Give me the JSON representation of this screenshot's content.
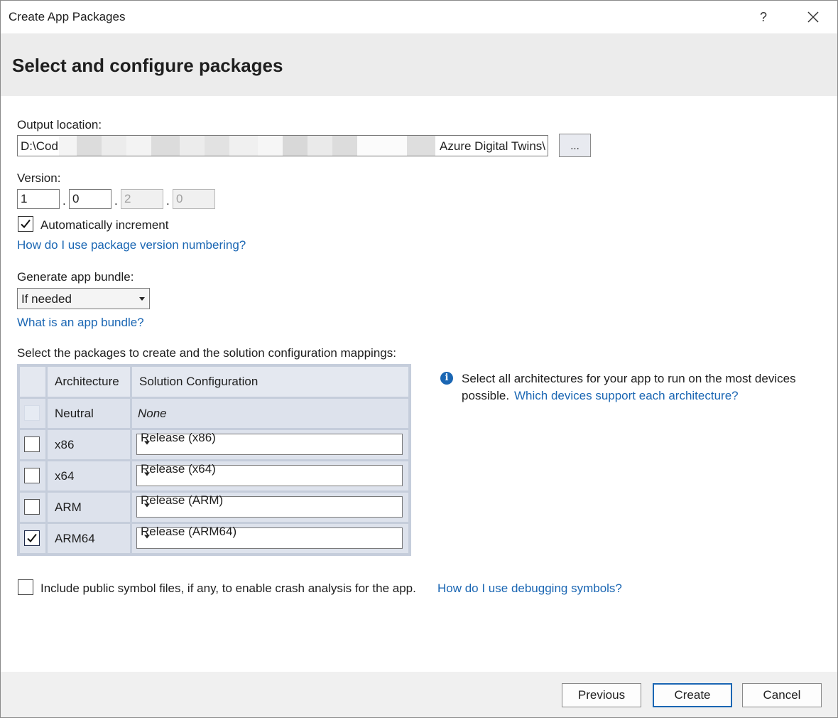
{
  "window": {
    "title": "Create App Packages",
    "help_glyph": "?"
  },
  "header": {
    "title": "Select and configure packages"
  },
  "output": {
    "label": "Output location:",
    "path_prefix": "D:\\Cod",
    "path_suffix": "Azure Digital Twins\\",
    "browse_label": "..."
  },
  "version": {
    "label": "Version:",
    "major": "1",
    "minor": "0",
    "build": "2",
    "revision": "0",
    "separator": ".",
    "auto_increment_label": "Automatically increment",
    "auto_increment_checked": true,
    "help_link": "How do I use package version numbering?"
  },
  "bundle": {
    "label": "Generate app bundle:",
    "value": "If needed",
    "help_link": "What is an app bundle?"
  },
  "packages": {
    "label": "Select the packages to create and the solution configuration mappings:",
    "columns": [
      "Architecture",
      "Solution Configuration"
    ],
    "rows": [
      {
        "arch": "Neutral",
        "config": "None",
        "checked": false
      },
      {
        "arch": "x86",
        "config": "Release (x86)",
        "checked": false
      },
      {
        "arch": "x64",
        "config": "Release (x64)",
        "checked": false
      },
      {
        "arch": "ARM",
        "config": "Release (ARM)",
        "checked": false
      },
      {
        "arch": "ARM64",
        "config": "Release (ARM64)",
        "checked": true
      }
    ]
  },
  "info": {
    "text_line1": "Select all architectures for your app to run on the most devices",
    "text_line2": "possible.",
    "link": "Which devices support each architecture?"
  },
  "symbols": {
    "label": "Include public symbol files, if any, to enable crash analysis for the app.",
    "link": "How do I use debugging symbols?",
    "checked": false
  },
  "footer": {
    "previous_label": "Previous",
    "create_label": "Create",
    "cancel_label": "Cancel"
  },
  "colors": {
    "accent": "#1a66b3",
    "header_bg": "#ececec",
    "grid_bg": "#dde2ec"
  }
}
